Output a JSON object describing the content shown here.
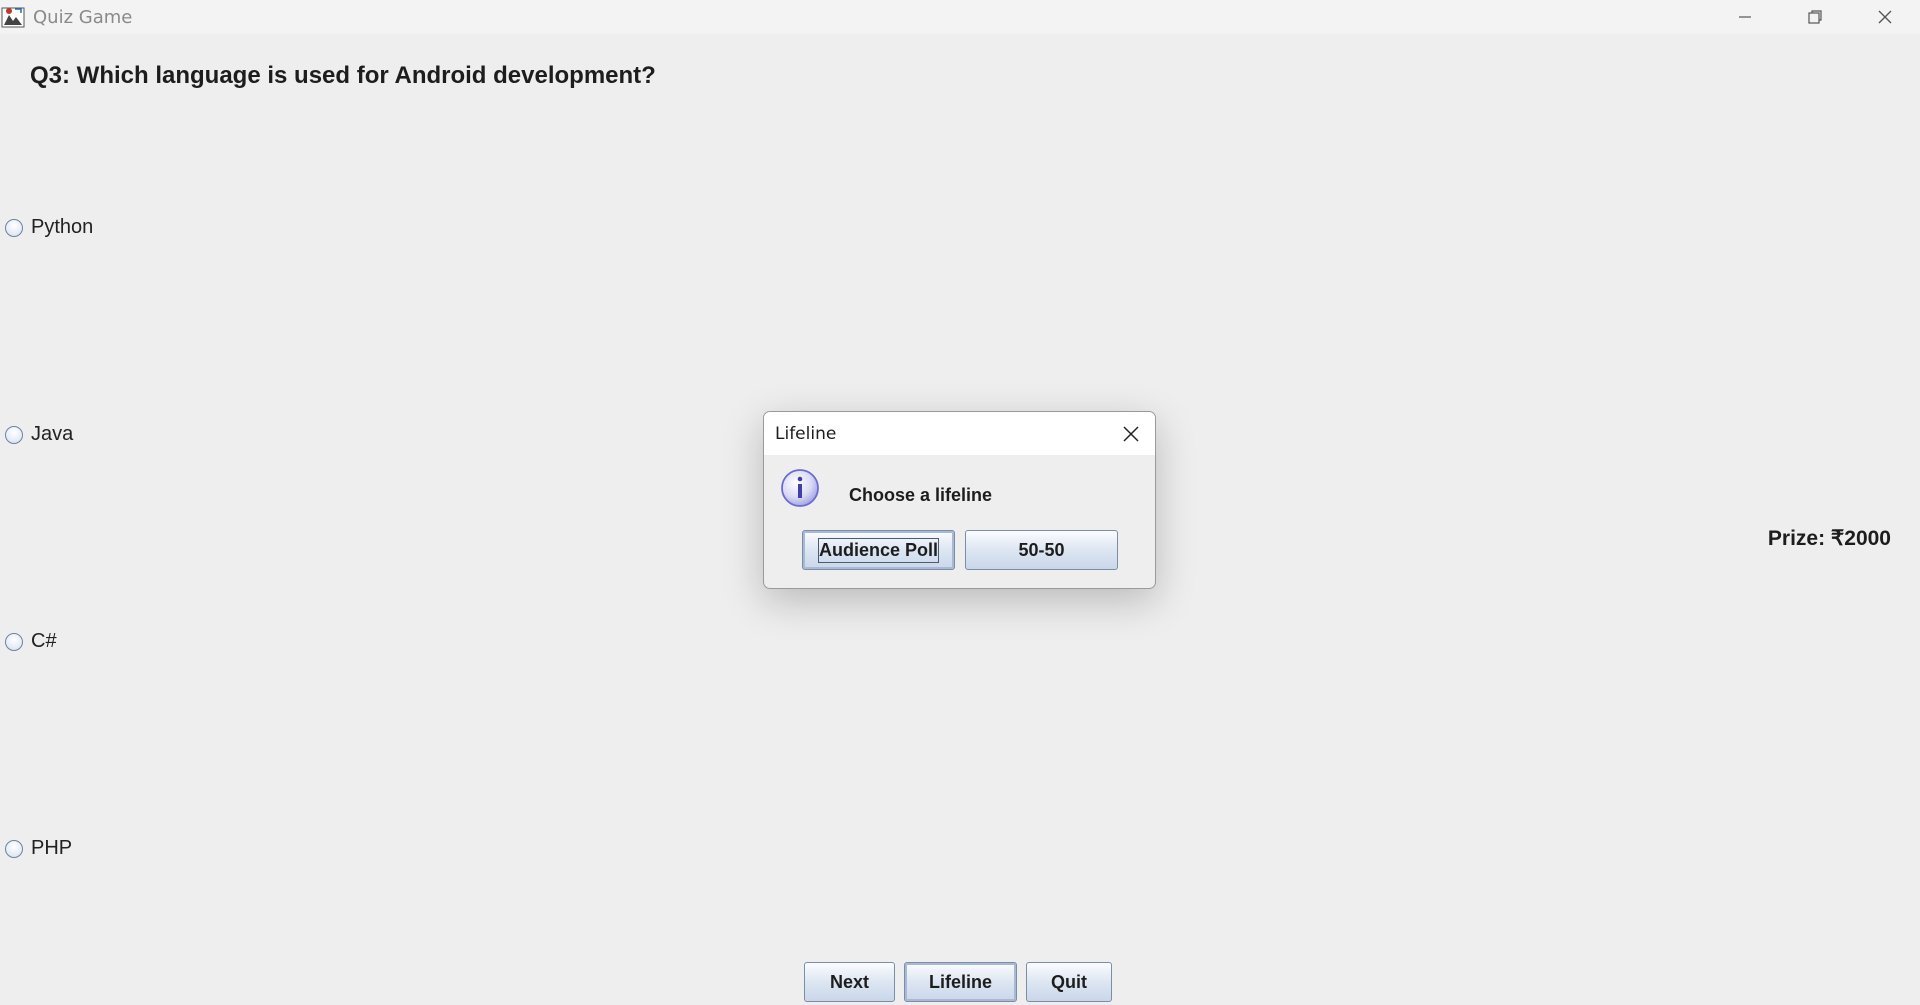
{
  "window": {
    "title": "Quiz Game",
    "icon": "quiz-app-icon"
  },
  "question": {
    "text": "Q3: Which language is used for Android development?"
  },
  "options": [
    {
      "label": "Python",
      "selected": false
    },
    {
      "label": "Java",
      "selected": false
    },
    {
      "label": "C#",
      "selected": false
    },
    {
      "label": "PHP",
      "selected": false
    }
  ],
  "prize": {
    "text": "Prize: ₹2000"
  },
  "buttons": {
    "next": "Next",
    "lifeline": "Lifeline",
    "quit": "Quit"
  },
  "dialog": {
    "title": "Lifeline",
    "message": "Choose a lifeline",
    "icon": "info-icon",
    "options": {
      "audience_poll": "Audience Poll",
      "fifty_fifty": "50-50"
    }
  },
  "colors": {
    "background": "#eeeeee",
    "button_border": "#7a8ea8",
    "info_icon": "#6b6bd6"
  }
}
